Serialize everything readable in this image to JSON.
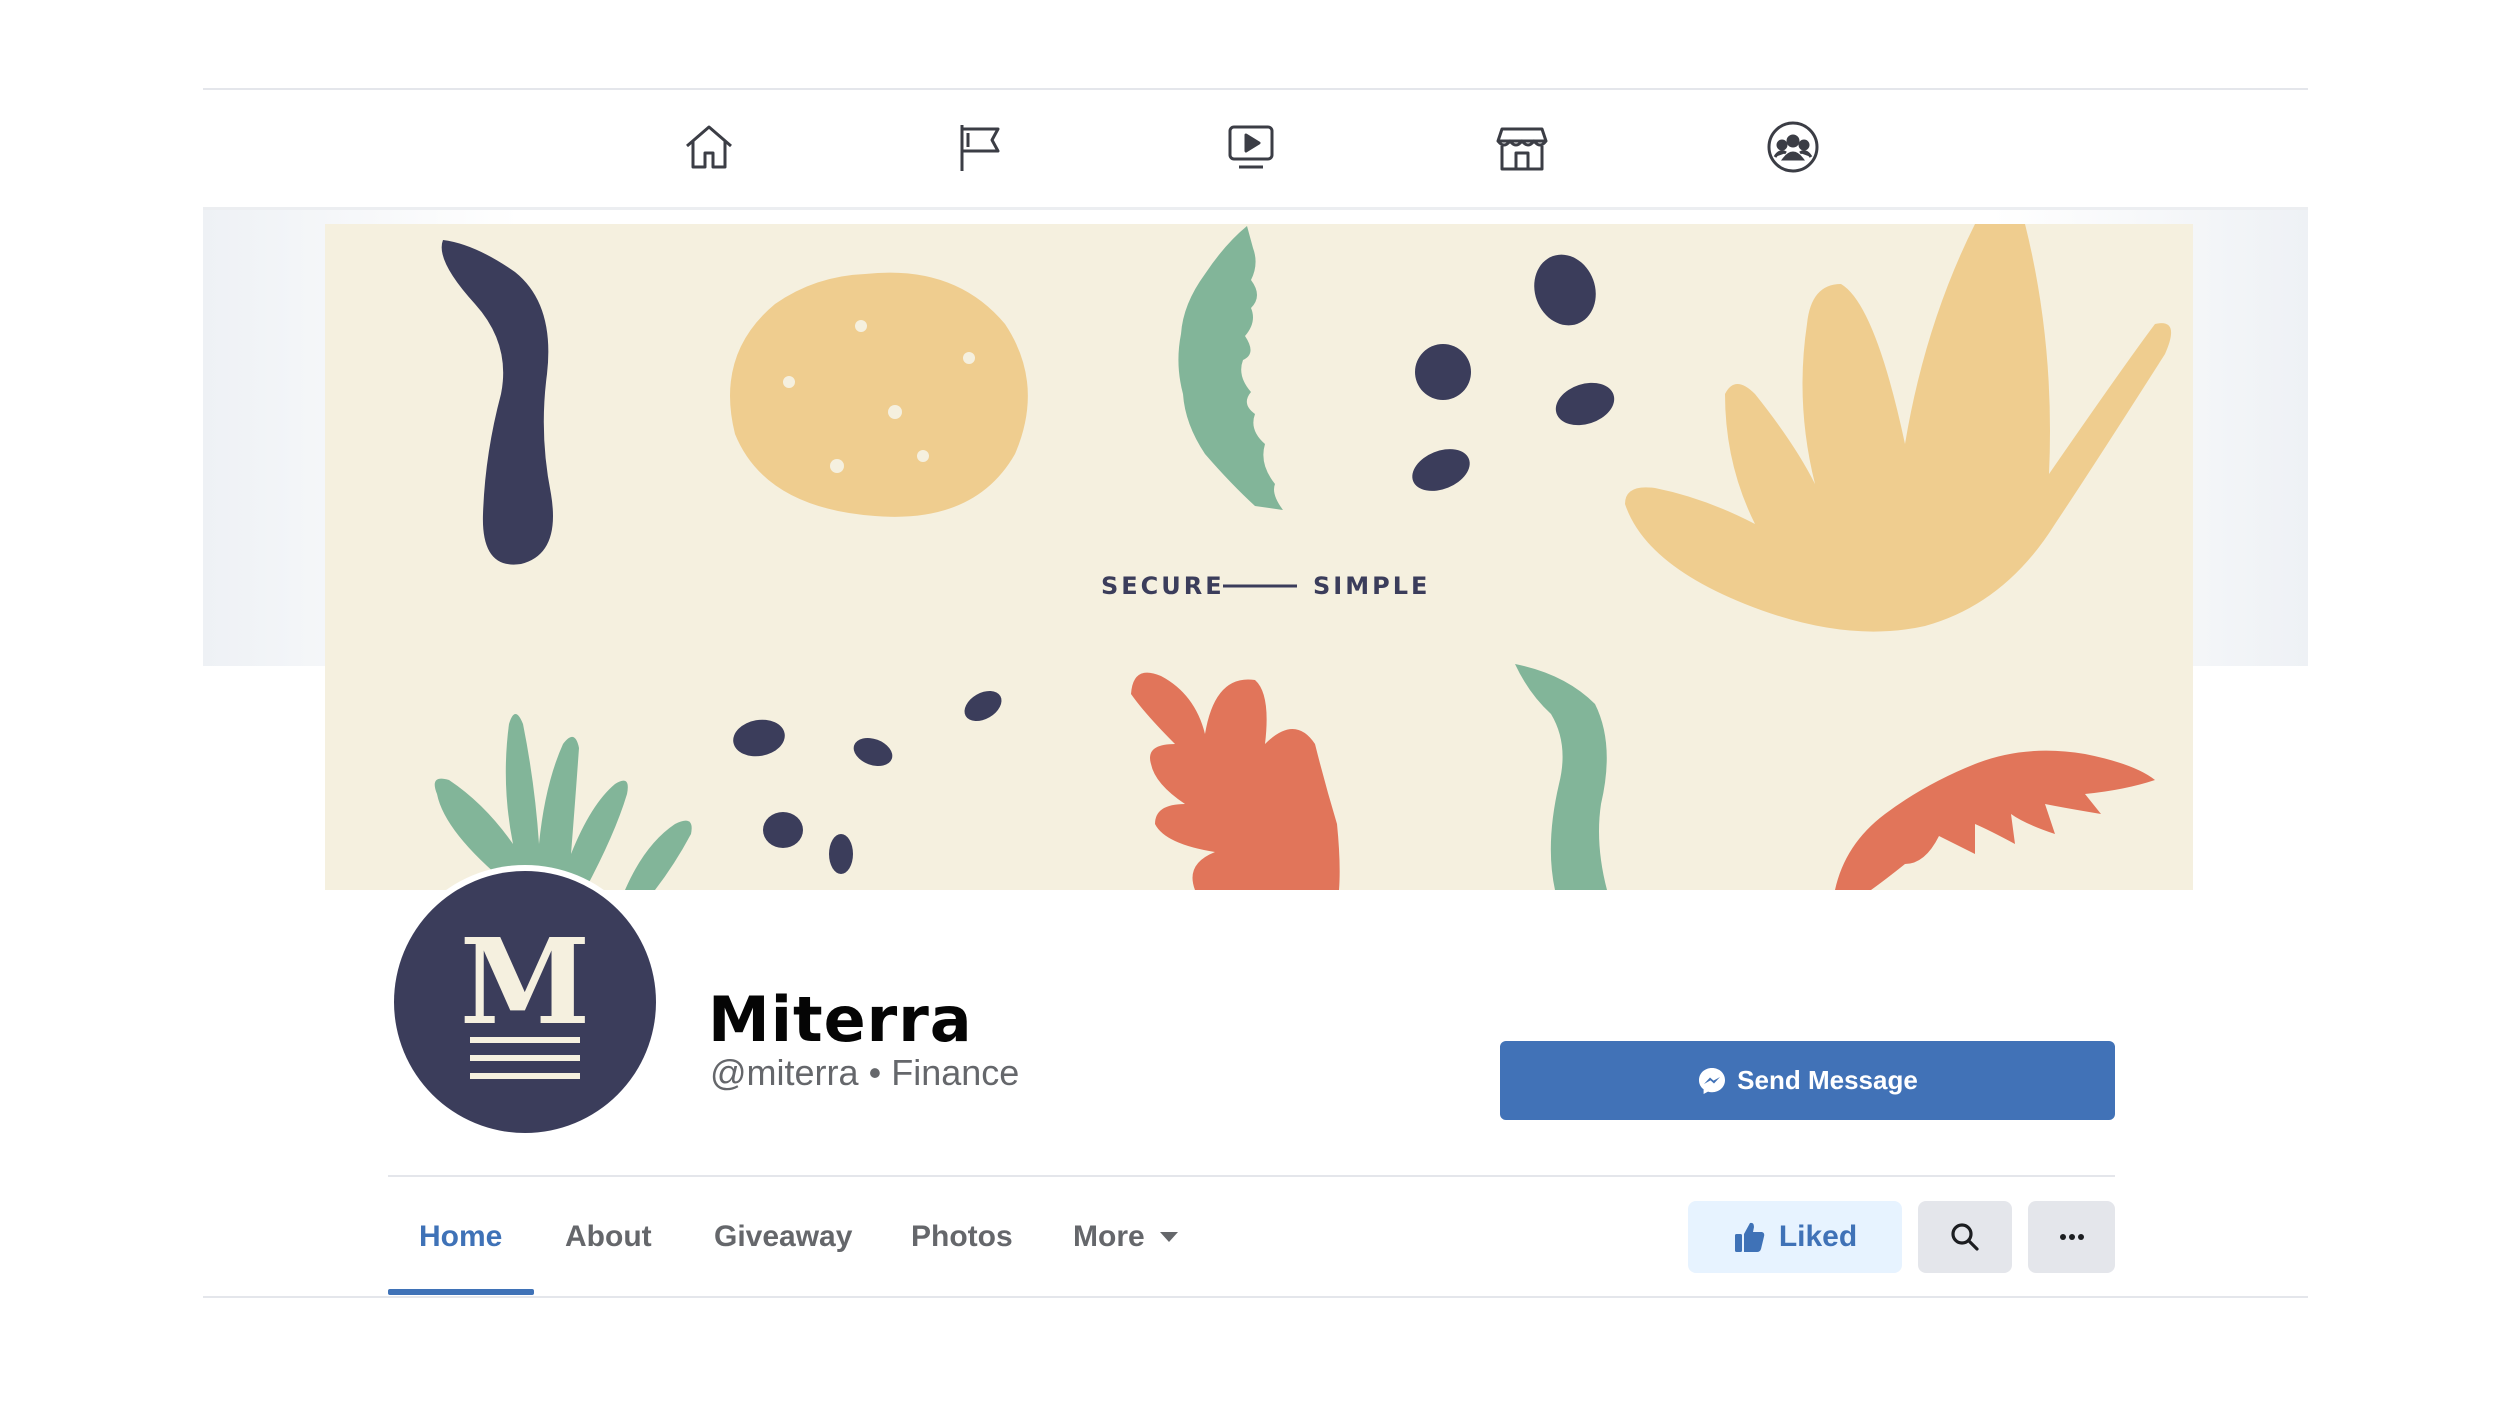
{
  "top_nav": {
    "icons": [
      "home-icon",
      "flag-icon",
      "video-icon",
      "marketplace-icon",
      "groups-icon"
    ]
  },
  "cover": {
    "tagline_left": "SECURE",
    "tagline_right": "SIMPLE",
    "colors": {
      "background": "#f5f0df",
      "navy": "#3b3d5b",
      "yellow": "#efcd8f",
      "green": "#82b599",
      "orange": "#e1755a"
    }
  },
  "profile": {
    "avatar_letter": "M",
    "name": "Miterra",
    "handle": "@miterra",
    "separator": "•",
    "category": "Finance",
    "send_message_label": "Send Message"
  },
  "tabs": [
    {
      "label": "Home",
      "active": true
    },
    {
      "label": "About",
      "active": false
    },
    {
      "label": "Giveaway",
      "active": false
    },
    {
      "label": "Photos",
      "active": false
    },
    {
      "label": "More",
      "active": false
    }
  ],
  "actions": {
    "liked_label": "Liked"
  },
  "colors": {
    "accent": "#3f72b7",
    "button_blue": "#4172b7",
    "text_primary": "#050505",
    "text_secondary": "#65676b"
  }
}
